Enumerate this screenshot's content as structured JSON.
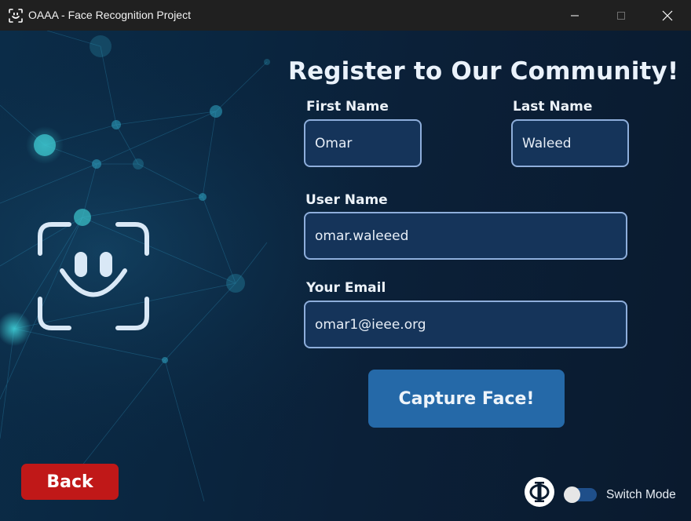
{
  "window": {
    "title": "OAAA - Face Recognition Project",
    "minimize_icon": "minimize-icon",
    "maximize_icon": "maximize-icon",
    "close_icon": "close-icon"
  },
  "form": {
    "heading": "Register to Our Community!",
    "first_name": {
      "label": "First Name",
      "value": "Omar"
    },
    "last_name": {
      "label": "Last Name",
      "value": "Waleed"
    },
    "user_name": {
      "label": "User Name",
      "value": "omar.waleeed"
    },
    "email": {
      "label": "Your Email",
      "value": "omar1@ieee.org"
    },
    "capture_button": "Capture Face!"
  },
  "footer": {
    "back_button": "Back",
    "switch_label": "Switch Mode",
    "switch_on": false,
    "logo_icon": "ieee-phi-logo"
  },
  "colors": {
    "background": "#0a1a2e",
    "input_fill": "#15345a",
    "input_border": "#8eaedb",
    "capture_button": "#2569a8",
    "back_button": "#c01818",
    "toggle_track": "#1f4f8a"
  }
}
